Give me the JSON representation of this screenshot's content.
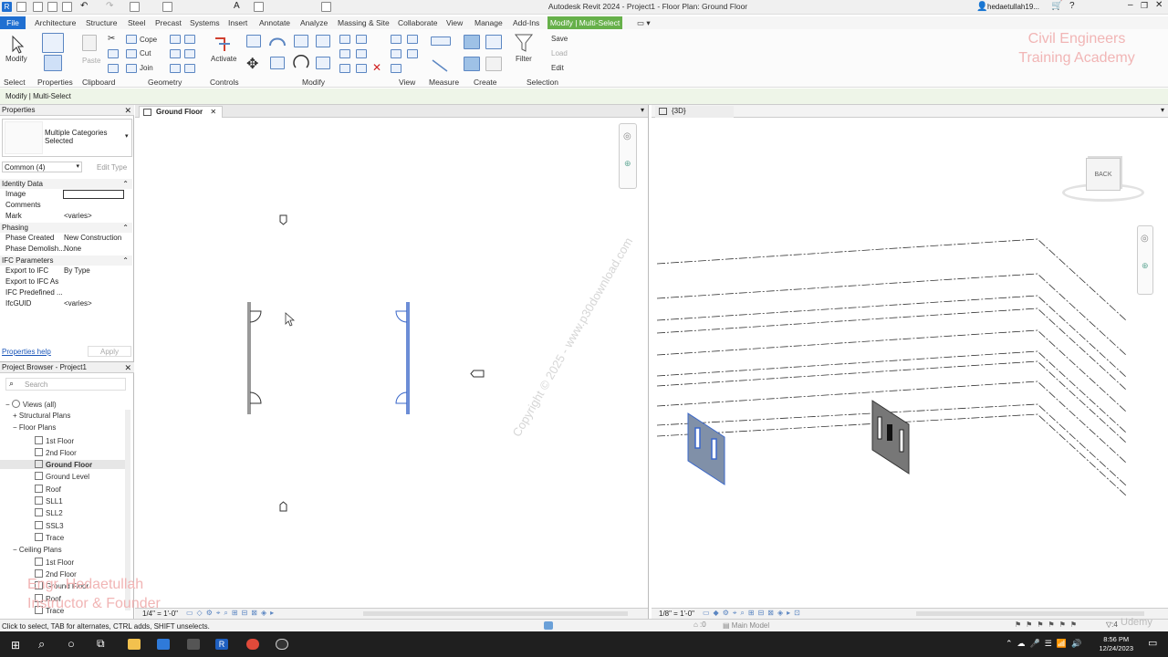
{
  "window": {
    "title": "Autodesk Revit 2024 - Project1 - Floor Plan: Ground Floor",
    "user": "hedaetullah19..."
  },
  "menu": {
    "file": "File",
    "items": [
      "Architecture",
      "Structure",
      "Steel",
      "Precast",
      "Systems",
      "Insert",
      "Annotate",
      "Analyze",
      "Massing & Site",
      "Collaborate",
      "View",
      "Manage",
      "Add-Ins"
    ],
    "context_tab": "Modify | Multi-Select"
  },
  "ribbon": {
    "groups": [
      "Select",
      "Properties",
      "Clipboard",
      "Geometry",
      "Controls",
      "Modify",
      "View",
      "Measure",
      "Create",
      "Selection"
    ],
    "modify_label": "Modify",
    "paste_label": "Paste",
    "cope_label": "Cope",
    "cut_label": "Cut",
    "join_label": "Join",
    "activate_label": "Activate",
    "filter_label": "Filter",
    "save_label": "Save",
    "load_label": "Load",
    "edit_label": "Edit"
  },
  "watermark": {
    "top_line1": "Civil Engineers",
    "top_line2": "Training Academy",
    "bottom_line1": "Engr. Hedaetullah",
    "bottom_line2": "Instructor & Founder",
    "copyright": "Copyright © 2025 - www.p30download.com"
  },
  "options_bar": {
    "text": "Modify | Multi-Select"
  },
  "properties": {
    "title": "Properties",
    "type_name": "Multiple Categories Selected",
    "filter": "Common (4)",
    "edit_type": "Edit Type",
    "sections": [
      {
        "name": "Identity Data",
        "rows": [
          {
            "k": "Image",
            "v": ""
          },
          {
            "k": "Comments",
            "v": ""
          },
          {
            "k": "Mark",
            "v": "<varies>"
          }
        ]
      },
      {
        "name": "Phasing",
        "rows": [
          {
            "k": "Phase Created",
            "v": "New Construction"
          },
          {
            "k": "Phase Demolish...",
            "v": "None"
          }
        ]
      },
      {
        "name": "IFC Parameters",
        "rows": [
          {
            "k": "Export to IFC",
            "v": "By Type"
          },
          {
            "k": "Export to IFC As",
            "v": ""
          },
          {
            "k": "IFC Predefined ...",
            "v": ""
          },
          {
            "k": "IfcGUID",
            "v": "<varies>"
          }
        ]
      }
    ],
    "help": "Properties help",
    "apply": "Apply"
  },
  "browser": {
    "title": "Project Browser - Project1",
    "search_placeholder": "Search",
    "tree": [
      {
        "label": "Views (all)",
        "level": 0
      },
      {
        "label": "Structural Plans",
        "level": 1
      },
      {
        "label": "Floor Plans",
        "level": 1
      },
      {
        "label": "1st Floor",
        "level": 2
      },
      {
        "label": "2nd Floor",
        "level": 2
      },
      {
        "label": "Ground Floor",
        "level": 2,
        "selected": true
      },
      {
        "label": "Ground Level",
        "level": 2
      },
      {
        "label": "Roof",
        "level": 2
      },
      {
        "label": "SLL1",
        "level": 2
      },
      {
        "label": "SLL2",
        "level": 2
      },
      {
        "label": "SSL3",
        "level": 2
      },
      {
        "label": "Trace",
        "level": 2
      },
      {
        "label": "Ceiling Plans",
        "level": 1
      },
      {
        "label": "1st Floor",
        "level": 2
      },
      {
        "label": "2nd Floor",
        "level": 2
      },
      {
        "label": "Ground Floor",
        "level": 2
      },
      {
        "label": "Roof",
        "level": 2
      },
      {
        "label": "Trace",
        "level": 2
      }
    ]
  },
  "views": {
    "left_tab": "Ground Floor",
    "right_tab": "{3D}",
    "left_scale": "1/4\" = 1'-0\"",
    "right_scale": "1/8\" = 1'-0\"",
    "viewcube": "BACK",
    "model": "Main Model"
  },
  "status": {
    "message": "Click to select, TAB for alternates, CTRL adds, SHIFT unselects.",
    "filter_count": ":4"
  },
  "taskbar": {
    "time": "8:56 PM",
    "date": "12/24/2023"
  },
  "brand": {
    "udemy": "Udemy"
  },
  "colors": {
    "file_blue": "#1f6fd1",
    "context_green": "#66b04a",
    "selection_blue": "#3a67c9"
  }
}
